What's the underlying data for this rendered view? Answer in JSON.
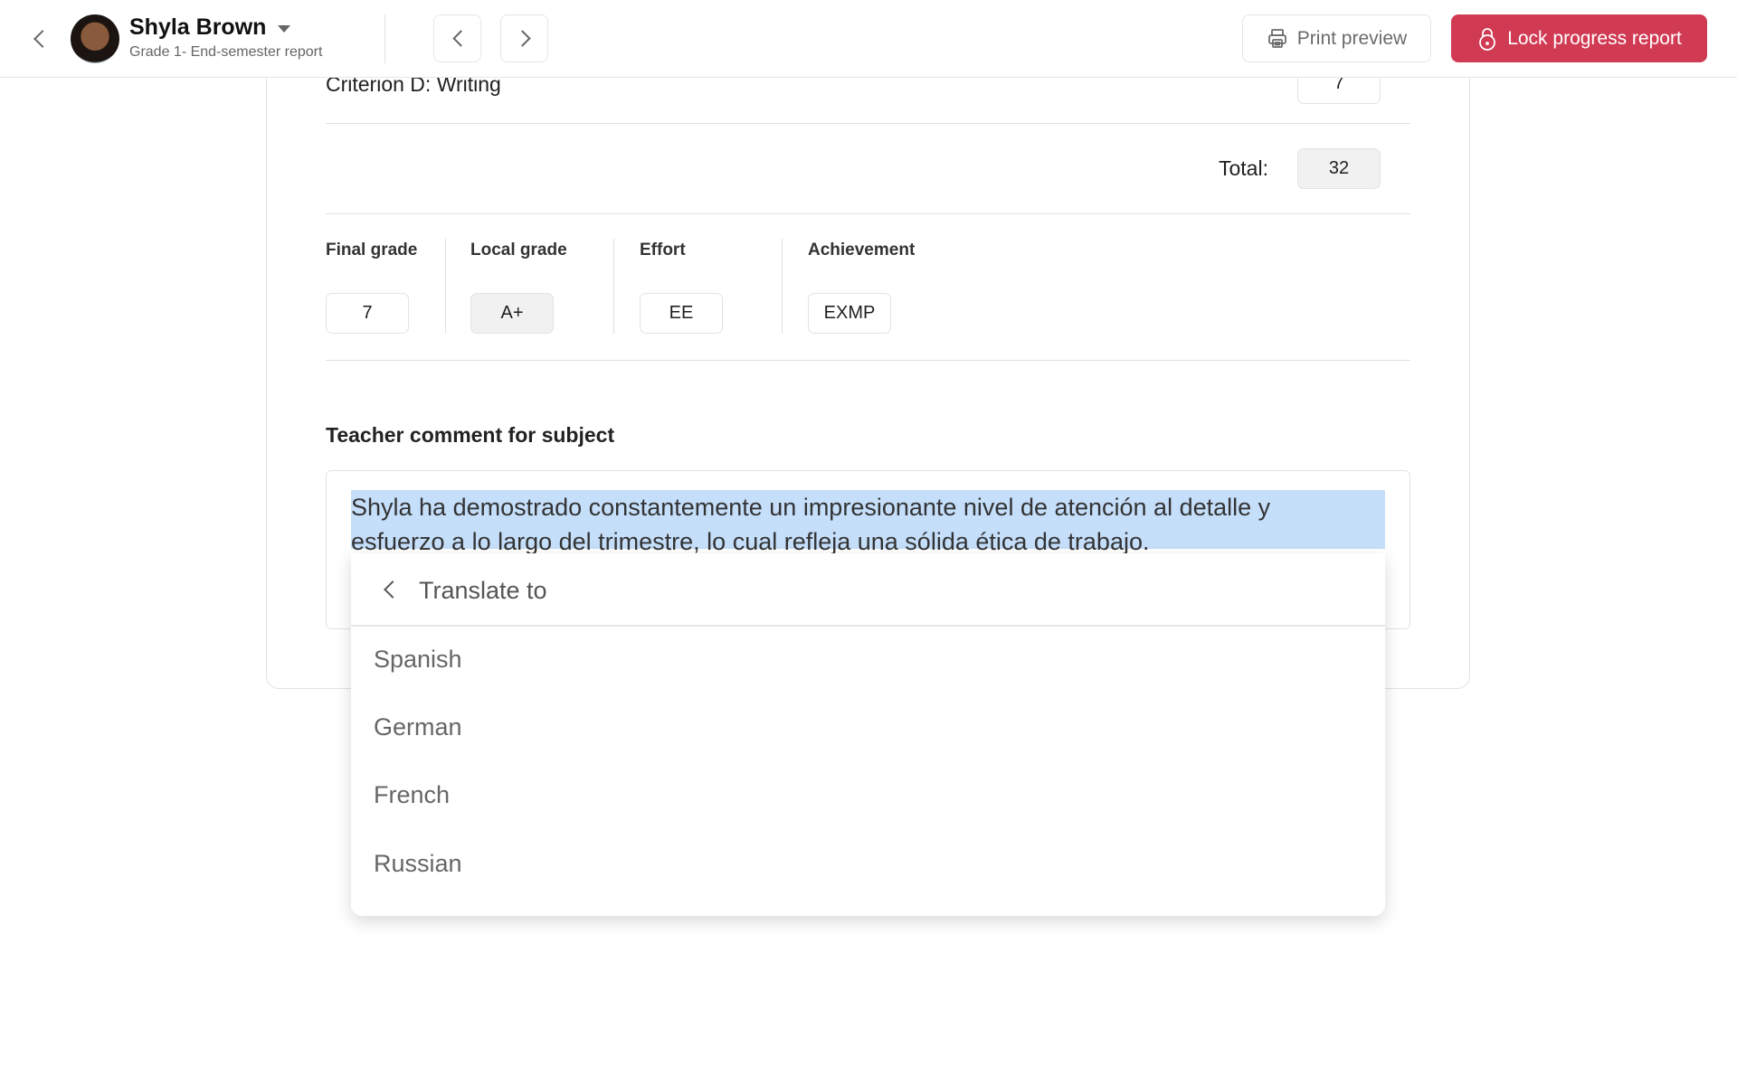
{
  "header": {
    "student_name": "Shyla Brown",
    "subtitle": "Grade 1- End-semester report",
    "print_label": "Print preview",
    "lock_label": "Lock progress report",
    "lock_color": "#d13a53"
  },
  "criteria": {
    "last_label": "Criterion D: Writing",
    "last_score": "7",
    "total_label": "Total:",
    "total_value": "32"
  },
  "grades": [
    {
      "label": "Final grade",
      "value": "7"
    },
    {
      "label": "Local grade",
      "value": "A+"
    },
    {
      "label": "Effort",
      "value": "EE"
    },
    {
      "label": "Achievement",
      "value": "EXMP"
    }
  ],
  "comment": {
    "heading": "Teacher comment for subject",
    "line1": "Shyla ha demostrado constantemente un impresionante nivel de atención al detalle y",
    "line2": "esfuerzo a lo largo del trimestre, lo cual refleja una sólida ética de trabajo."
  },
  "translate_menu": {
    "title": "Translate to",
    "options": [
      "Spanish",
      "German",
      "French",
      "Russian"
    ]
  }
}
